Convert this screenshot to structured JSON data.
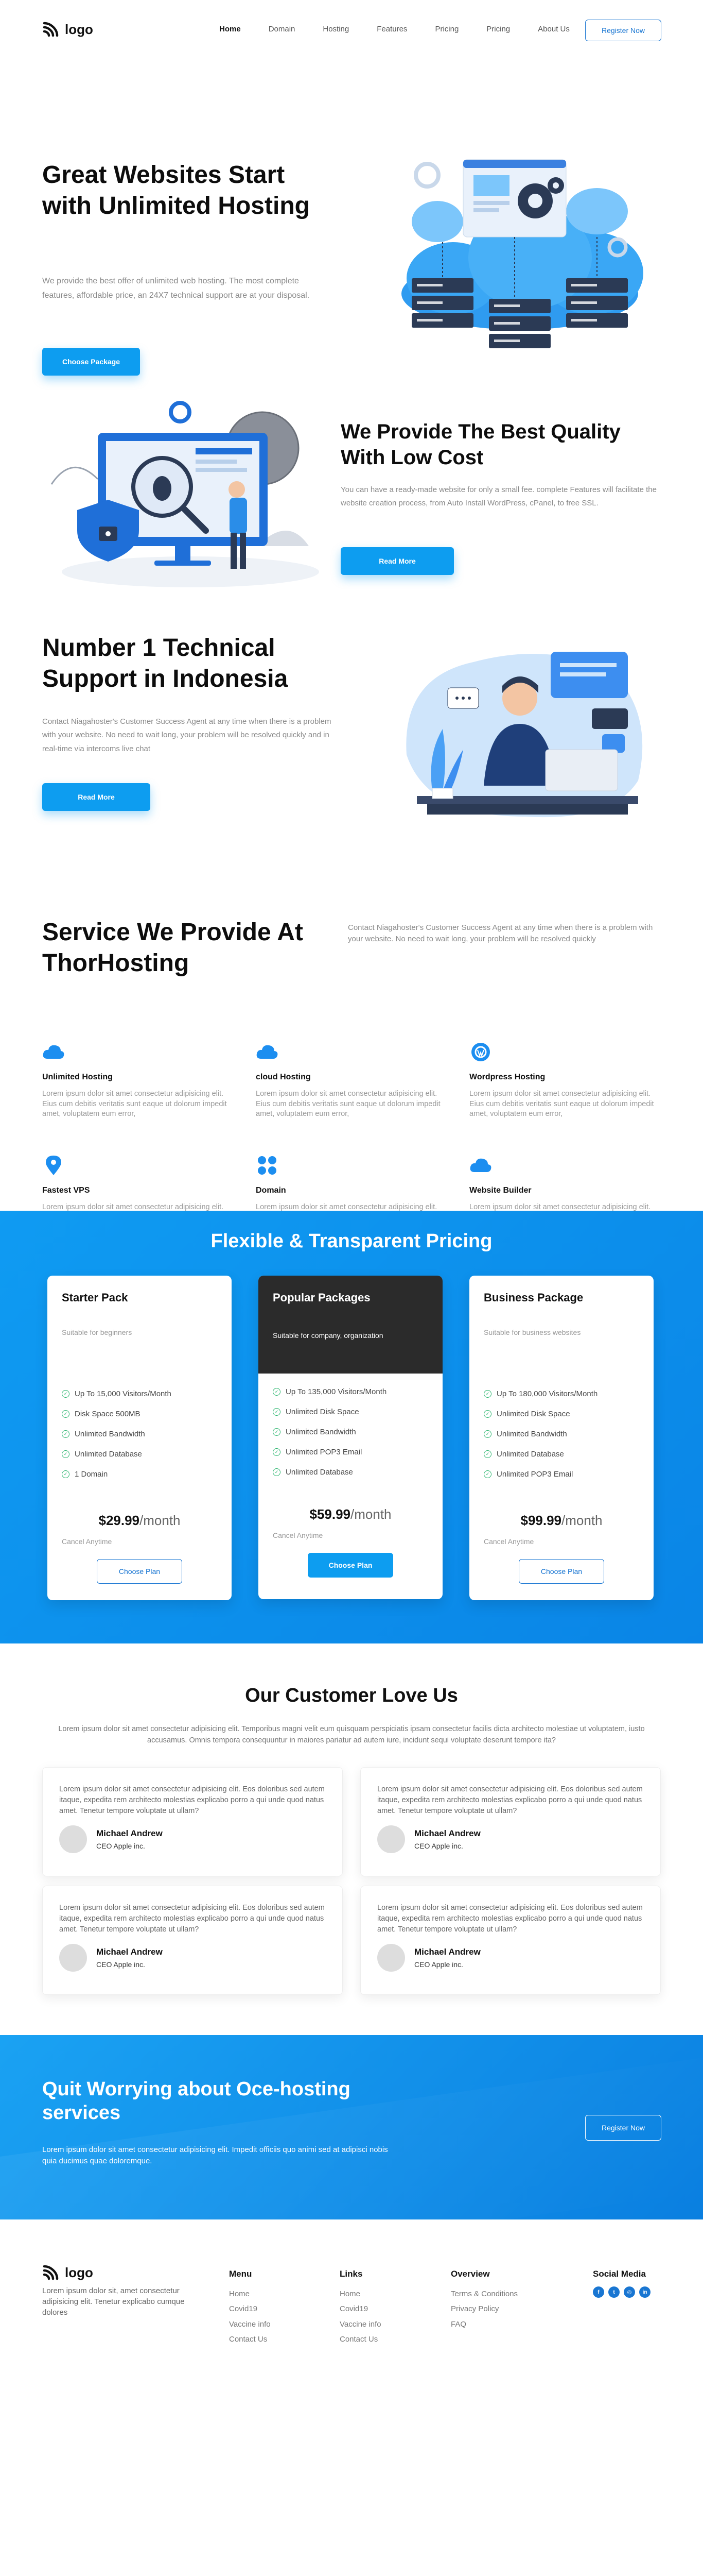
{
  "brand": {
    "name": "logo",
    "primary": "#0d9df0",
    "dark_card": "#2b2b2b"
  },
  "nav": {
    "links": [
      "Home",
      "Domain",
      "Hosting",
      "Features",
      "Pricing",
      "Pricing",
      "About Us"
    ],
    "register": "Register Now"
  },
  "hero1": {
    "title": "Great Websites Start with Unlimited Hosting",
    "text": "We provide the best offer of unlimited web hosting. The most complete features, affordable price, an 24X7 technical support are at your disposal.",
    "button": "Choose Package"
  },
  "hero2": {
    "title": "We Provide The Best Quality With Low Cost",
    "text": "You can have a ready-made website for only a small fee. complete Features will facilitate the website creation process, from Auto Install WordPress, cPanel, to free SSL.",
    "button": "Read More"
  },
  "hero3": {
    "title": "Number 1 Technical Support in Indonesia",
    "text": "Contact Niagahoster's Customer Success Agent at any time when there is a problem with your website. No need to wait long, your problem will be resolved quickly and in real-time via intercoms live chat",
    "button": "Read More"
  },
  "services": {
    "title": "Service We Provide At ThorHosting",
    "subtitle": "Contact Niagahoster's Customer Success Agent at any time when there is a problem with your website. No need to wait long, your problem will be resolved quickly",
    "items": [
      {
        "icon": "cloud-icon",
        "title": "Unlimited Hosting",
        "text": "Lorem ipsum dolor sit amet consectetur adipisicing elit. Eius cum debitis veritatis sunt eaque ut dolorum impedit amet, voluptatem eum error,"
      },
      {
        "icon": "cloud-icon",
        "title": "cloud Hosting",
        "text": "Lorem ipsum dolor sit amet consectetur adipisicing elit. Eius cum debitis veritatis sunt eaque ut dolorum impedit amet, voluptatem eum error,"
      },
      {
        "icon": "wordpress-icon",
        "title": "Wordpress Hosting",
        "text": "Lorem ipsum dolor sit amet consectetur adipisicing elit. Eius cum debitis veritatis sunt eaque ut dolorum impedit amet, voluptatem eum error,"
      },
      {
        "icon": "pin-icon",
        "title": "Fastest VPS",
        "text": "Lorem ipsum dolor sit amet consectetur adipisicing elit. Eius cum debitis veritatis sunt eaque ut dolorum impedit amet, voluptatem eum error,"
      },
      {
        "icon": "grid-icon",
        "title": "Domain",
        "text": "Lorem ipsum dolor sit amet consectetur adipisicing elit. Eius cum debitis veritatis sunt eaque ut dolorum impedit amet, voluptatem eum error,"
      },
      {
        "icon": "cloud-icon",
        "title": "Website Builder",
        "text": "Lorem ipsum dolor sit amet consectetur adipisicing elit. Eius cum debitis veritatis sunt eaque ut dolorum impedit amet, voluptatem eum error,"
      }
    ]
  },
  "pricing": {
    "title": "Flexible & Transparent Pricing",
    "plans": [
      {
        "name": "Starter Pack",
        "tagline": "Suitable for beginners",
        "features": [
          "Up To 15,000 Visitors/Month",
          "Disk Space 500MB",
          "Unlimited Bandwidth",
          "Unlimited Database",
          "1 Domain"
        ],
        "price": "$29.99",
        "period": "/month",
        "cancel": "Cancel Anytime",
        "button": "Choose Plan"
      },
      {
        "name": "Popular Packages",
        "tagline": "Suitable for company, organization",
        "features": [
          "Up To 135,000 Visitors/Month",
          "Unlimited Disk Space",
          "Unlimited Bandwidth",
          "Unlimited POP3 Email",
          "Unlimited Database"
        ],
        "price": "$59.99",
        "period": "/month",
        "cancel": "Cancel Anytime",
        "button": "Choose Plan"
      },
      {
        "name": "Business Package",
        "tagline": "Suitable for business websites",
        "features": [
          "Up To 180,000 Visitors/Month",
          "Unlimited Disk Space",
          "Unlimited Bandwidth",
          "Unlimited Database",
          "Unlimited POP3 Email"
        ],
        "price": "$99.99",
        "period": "/month",
        "cancel": "Cancel Anytime",
        "button": "Choose Plan"
      }
    ]
  },
  "testimonials": {
    "title": "Our Customer Love Us",
    "subtitle": "Lorem ipsum dolor sit amet consectetur adipisicing elit. Temporibus magni velit eum quisquam perspiciatis ipsam consectetur facilis dicta architecto molestiae ut voluptatem, iusto accusamus. Omnis tempora consequuntur in maiores pariatur ad autem iure, incidunt sequi voluptate deserunt tempore ita?",
    "items": [
      {
        "text": "Lorem ipsum dolor sit amet consectetur adipisicing elit. Eos doloribus sed autem itaque, expedita rem architecto molestias explicabo porro a qui unde quod natus amet. Tenetur tempore voluptate ut ullam?",
        "name": "Michael Andrew",
        "role": "CEO Apple inc."
      },
      {
        "text": "Lorem ipsum dolor sit amet consectetur adipisicing elit. Eos doloribus sed autem itaque, expedita rem architecto molestias explicabo porro a qui unde quod natus amet. Tenetur tempore voluptate ut ullam?",
        "name": "Michael Andrew",
        "role": "CEO Apple inc."
      },
      {
        "text": "Lorem ipsum dolor sit amet consectetur adipisicing elit. Eos doloribus sed autem itaque, expedita rem architecto molestias explicabo porro a qui unde quod natus amet. Tenetur tempore voluptate ut ullam?",
        "name": "Michael Andrew",
        "role": "CEO Apple inc."
      },
      {
        "text": "Lorem ipsum dolor sit amet consectetur adipisicing elit. Eos doloribus sed autem itaque, expedita rem architecto molestias explicabo porro a qui unde quod natus amet. Tenetur tempore voluptate ut ullam?",
        "name": "Michael Andrew",
        "role": "CEO Apple inc."
      }
    ]
  },
  "cta": {
    "title": "Quit Worrying about Oce-hosting services",
    "text": "Lorem ipsum dolor sit amet consectetur adipisicing elit. Impedit officiis quo animi sed at adipisci nobis quia ducimus quae doloremque.",
    "button": "Register Now"
  },
  "footer": {
    "about": "Lorem ipsum dolor sit, amet consectetur adipisicing elit. Tenetur explicabo cumque dolores",
    "columns": [
      {
        "title": "Menu",
        "links": [
          "Home",
          "Covid19",
          "Vaccine info",
          "Contact Us"
        ]
      },
      {
        "title": "Links",
        "links": [
          "Home",
          "Covid19",
          "Vaccine info",
          "Contact Us"
        ]
      },
      {
        "title": "Overview",
        "links": [
          "Terms & Conditions",
          "Privacy Policy",
          "FAQ"
        ]
      }
    ],
    "social_title": "Social Media",
    "social": [
      "facebook-icon",
      "twitter-icon",
      "instagram-icon",
      "linkedin-icon"
    ]
  }
}
